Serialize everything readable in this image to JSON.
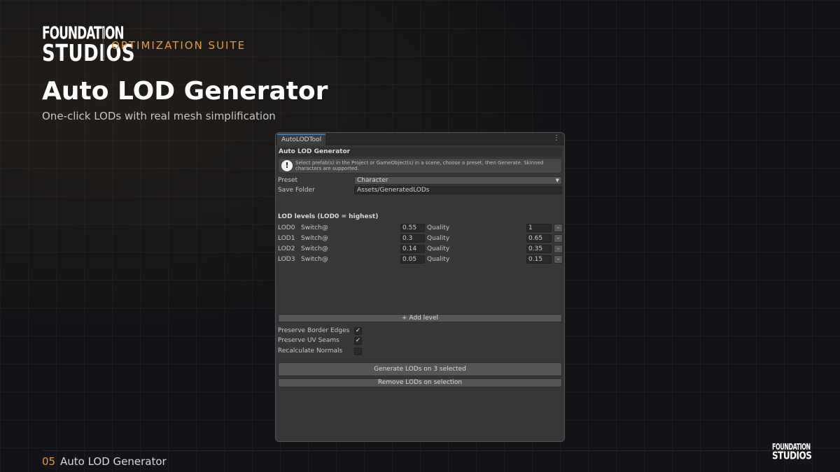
{
  "brand": {
    "line1": "FOUNDATION",
    "line2": "STUDIOS",
    "suite": "OPTIMIZATION SUITE",
    "accent": "#e89a3c"
  },
  "header": {
    "title": "Auto LOD Generator",
    "subtitle": "One-click LODs with real mesh simplification"
  },
  "footer": {
    "page_num": "05",
    "page_label": "Auto LOD Generator"
  },
  "window": {
    "tab": "AutoLODTool",
    "kebab": "⋮",
    "section_title": "Auto LOD Generator",
    "help_icon": "!",
    "help_text": "Select prefab(s) in the Project or GameObject(s) in a scene, choose a preset, then Generate. Skinned characters are supported.",
    "preset_label": "Preset",
    "preset_value": "Character",
    "preset_caret": "▼",
    "save_label": "Save Folder",
    "save_value": "Assets/GeneratedLODs",
    "lod_heading": "LOD levels (LOD0 = highest)",
    "switch_label": "Switch@",
    "quality_label": "Quality",
    "remove_label": "-",
    "lods": [
      {
        "name": "LOD0",
        "switch": "0.55",
        "quality": "1"
      },
      {
        "name": "LOD1",
        "switch": "0.3",
        "quality": "0.65"
      },
      {
        "name": "LOD2",
        "switch": "0.14",
        "quality": "0.35"
      },
      {
        "name": "LOD3",
        "switch": "0.05",
        "quality": "0.15"
      }
    ],
    "add_level": "+ Add level",
    "options": [
      {
        "label": "Preserve Border Edges",
        "mark": "✓"
      },
      {
        "label": "Preserve UV Seams",
        "mark": "✓"
      },
      {
        "label": "Recalculate Normals",
        "mark": ""
      }
    ],
    "generate": "Generate LODs on 3 selected",
    "remove": "Remove LODs on selection"
  }
}
